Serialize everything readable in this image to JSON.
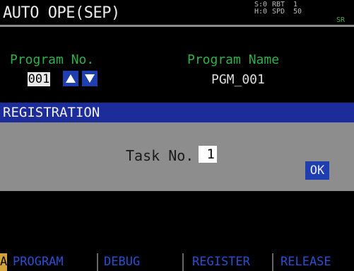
{
  "header": {
    "title": "AUTO OPE(SEP)",
    "status_1": "S:0\nH:0",
    "status_2": "RBT\nSPD",
    "status_3": "1\n50",
    "status_4": "",
    "status_5": "SR"
  },
  "program": {
    "number_label": "Program No.",
    "number_value": "001",
    "name_label": "Program Name",
    "name_value": "PGM_001"
  },
  "dialog": {
    "title": "REGISTRATION",
    "task_label": "Task No.",
    "task_value": "1",
    "ok_label": "OK"
  },
  "function_keys": {
    "indicator": "A",
    "program": "PROGRAM",
    "debug": "DEBUG",
    "register": "REGISTER",
    "release": "RELEASE"
  },
  "colors": {
    "dialog_header": "#1c2d9b",
    "dialog_body": "#8d8d8d",
    "label_green": "#2fb14a",
    "fkey_text": "#2a4fd0"
  }
}
